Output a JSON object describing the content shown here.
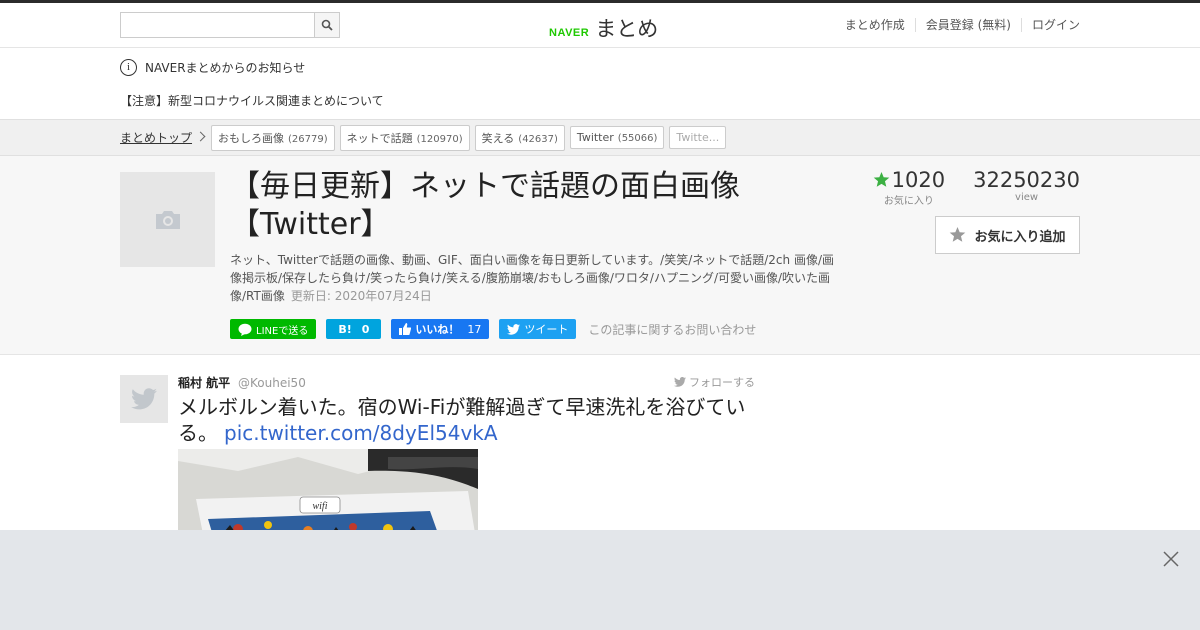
{
  "header": {
    "search_placeholder": "",
    "logo_brand": "NAVER",
    "logo_text": "まとめ",
    "nav": [
      "まとめ作成",
      "会員登録 (無料)",
      "ログイン"
    ]
  },
  "notice": {
    "title": "NAVERまとめからのお知らせ",
    "message": "【注意】新型コロナウイルス関連まとめについて"
  },
  "breadcrumb": {
    "top_label": "まとめトップ",
    "tags": [
      {
        "label": "おもしろ画像",
        "count": "(26779)"
      },
      {
        "label": "ネットで話題",
        "count": "(120970)"
      },
      {
        "label": "笑える",
        "count": "(42637)"
      },
      {
        "label": "Twitter",
        "count": "(55066)"
      },
      {
        "label": "Twitte...",
        "count": ""
      }
    ]
  },
  "article": {
    "title": "【毎日更新】ネットで話題の面白画像【Twitter】",
    "description": "ネット、Twitterで話題の画像、動画、GIF、面白い画像を毎日更新しています。/笑笑/ネットで話題/2ch 画像/画像掲示板/保存したら負け/笑ったら負け/笑える/腹筋崩壊/おもしろ画像/ワロタ/ハプニング/可愛い画像/吹いた画像/RT画像",
    "updated": "更新日: 2020年07月24日",
    "favorites_count": "1020",
    "favorites_label": "お気に入り",
    "views_count": "32250230",
    "views_label": "view",
    "fav_button": "お気に入り追加"
  },
  "share": {
    "line": "LINEで送る",
    "hatena_icon": "B!",
    "hatena_count": "0",
    "facebook_label": "いいね！",
    "facebook_count": "17",
    "twitter_label": "ツイート",
    "contact": "この記事に関するお問い合わせ"
  },
  "tweet": {
    "name": "稲村 航平",
    "handle": "@Kouhei50",
    "follow": "フォローする",
    "text": "メルボルン着いた。宿のWi-Fiが難解過ぎて早速洗礼を浴びている。",
    "link": "pic.twitter.com/8dyEl54vkA"
  },
  "colors": {
    "naver_green": "#1ec800",
    "line_green": "#00b900",
    "hatena_blue": "#00a4de",
    "facebook_blue": "#1877f2",
    "twitter_blue": "#1da1f2",
    "star_green": "#3cb043"
  },
  "icons": [
    "search-icon",
    "info-icon",
    "camera-icon",
    "star-icon",
    "twitter-bird-icon",
    "close-icon"
  ]
}
